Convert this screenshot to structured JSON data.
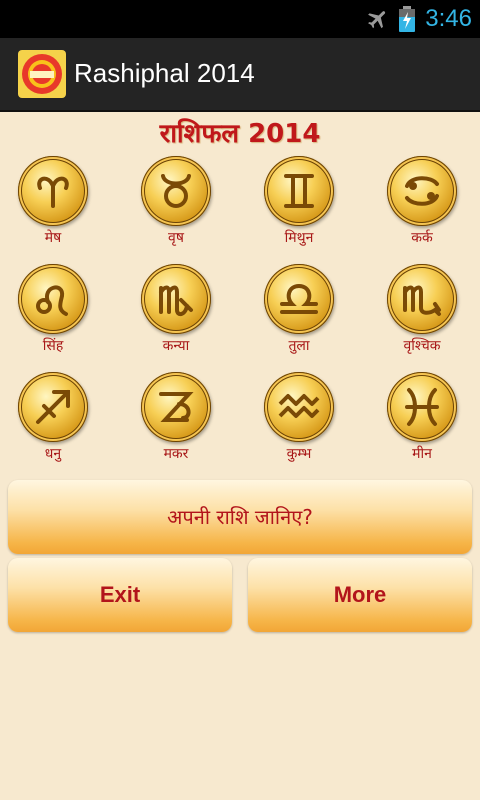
{
  "status_bar": {
    "time": "3:46"
  },
  "action_bar": {
    "title": "Rashiphal 2014",
    "icon_name": "app-logo-icon"
  },
  "heading": "राशिफल 2014",
  "signs": [
    {
      "name": "मेष",
      "icon": "aries-icon"
    },
    {
      "name": "वृष",
      "icon": "taurus-icon"
    },
    {
      "name": "मिथुन",
      "icon": "gemini-icon"
    },
    {
      "name": "कर्क",
      "icon": "cancer-icon"
    },
    {
      "name": "सिंह",
      "icon": "leo-icon"
    },
    {
      "name": "कन्या",
      "icon": "virgo-icon"
    },
    {
      "name": "तुला",
      "icon": "libra-icon"
    },
    {
      "name": "वृश्चिक",
      "icon": "scorpio-icon"
    },
    {
      "name": "धनु",
      "icon": "sagittarius-icon"
    },
    {
      "name": "मकर",
      "icon": "capricorn-icon"
    },
    {
      "name": "कुम्भ",
      "icon": "aquarius-icon"
    },
    {
      "name": "मीन",
      "icon": "pisces-icon"
    }
  ],
  "buttons": {
    "know_sign": "अपनी राशि जानिए?",
    "exit": "Exit",
    "more": "More"
  },
  "colors": {
    "background": "#f7e9cf",
    "accent_text": "#c0181b",
    "clock": "#33b5e5",
    "action_bar": "#242424"
  }
}
